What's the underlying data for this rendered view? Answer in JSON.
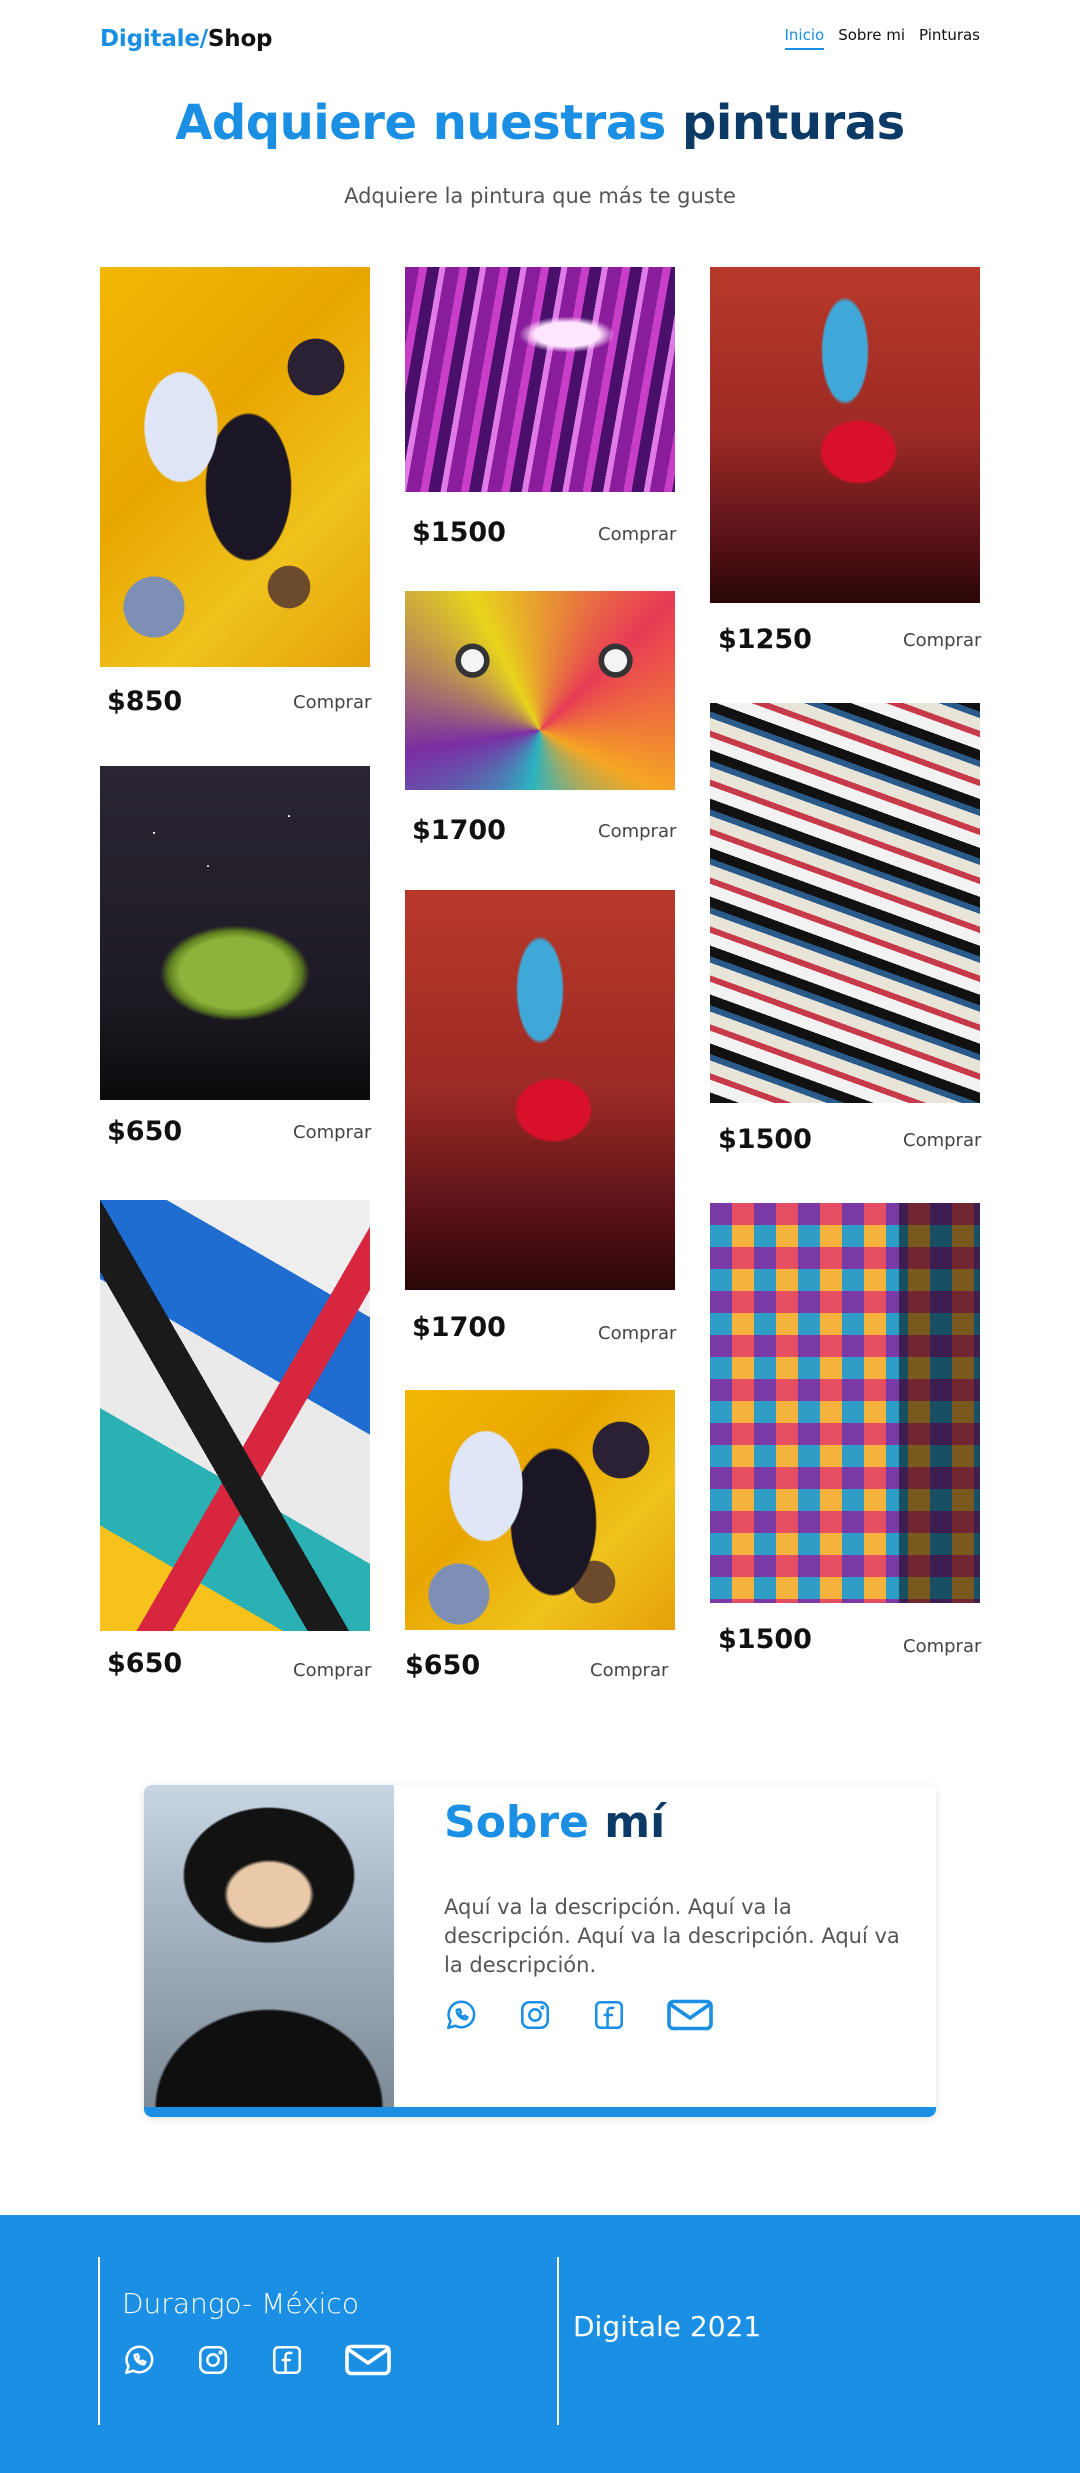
{
  "header": {
    "brand_part1": "Digitale/",
    "brand_part2": "Shop",
    "nav": [
      {
        "label": "Inicio",
        "active": true
      },
      {
        "label": "Sobre mi",
        "active": false
      },
      {
        "label": "Pinturas",
        "active": false
      }
    ]
  },
  "hero": {
    "title_part1": "Adquiere nuestras",
    "title_part2": "pinturas",
    "subtitle": "Adquiere la pintura que más te guste"
  },
  "products": [
    {
      "price": "$850",
      "buy_label": "Comprar"
    },
    {
      "price": "$1500",
      "buy_label": "Comprar"
    },
    {
      "price": "$1250",
      "buy_label": "Comprar"
    },
    {
      "price": "$1700",
      "buy_label": "Comprar"
    },
    {
      "price": "$650",
      "buy_label": "Comprar"
    },
    {
      "price": "$1500",
      "buy_label": "Comprar"
    },
    {
      "price": "$1700",
      "buy_label": "Comprar"
    },
    {
      "price": "$650",
      "buy_label": "Comprar"
    },
    {
      "price": "$650",
      "buy_label": "Comprar"
    },
    {
      "price": "$1500",
      "buy_label": "Comprar"
    }
  ],
  "about": {
    "title_part1": "Sobre",
    "title_part2": "mí",
    "description": "Aquí va la descripción. Aquí va la descripción. Aquí va la descripción. Aquí va la descripción."
  },
  "social_icons": [
    "whatsapp-icon",
    "instagram-icon",
    "facebook-icon",
    "mail-icon"
  ],
  "footer": {
    "location": "Durango- México",
    "copyright": "Digitale 2021"
  },
  "colors": {
    "accent": "#1a8fe3",
    "dark_blue": "#0b3a66"
  }
}
